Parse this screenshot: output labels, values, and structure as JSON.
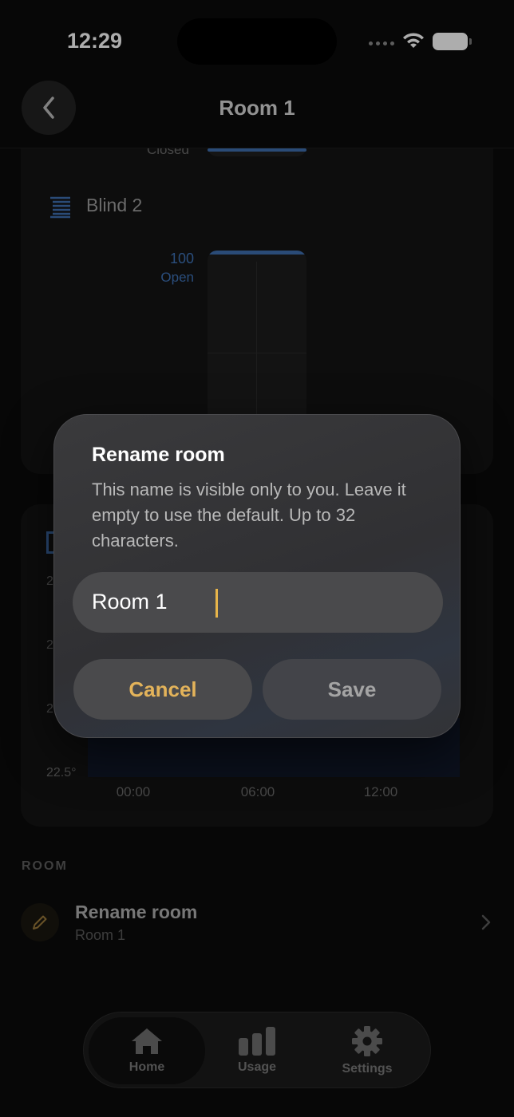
{
  "status_bar": {
    "time": "12:29"
  },
  "header": {
    "title": "Room 1"
  },
  "blind1": {
    "position_label": "Closed"
  },
  "blind2": {
    "name": "Blind 2",
    "value": "100",
    "state": "Open"
  },
  "temperature_chart": {
    "y_ticks": [
      "2",
      "2",
      "2",
      "22.5°"
    ],
    "x_ticks": [
      "00:00",
      "06:00",
      "12:00"
    ]
  },
  "room_section": {
    "label": "ROOM",
    "rename_title": "Rename room",
    "rename_subtitle": "Room 1"
  },
  "tabbar": {
    "tabs": [
      {
        "label": "Home",
        "icon": "house-icon",
        "active": true
      },
      {
        "label": "Usage",
        "icon": "bar-chart-icon",
        "active": false
      },
      {
        "label": "Settings",
        "icon": "gear-icon",
        "active": false
      }
    ]
  },
  "dialog": {
    "title": "Rename room",
    "message": "This name is visible only to you. Leave it empty to use the default. Up to 32 characters.",
    "input_value": "Room 1",
    "cancel_label": "Cancel",
    "save_label": "Save"
  },
  "colors": {
    "accent": "#e3b35a",
    "blind_blue": "#3e6fb0"
  }
}
